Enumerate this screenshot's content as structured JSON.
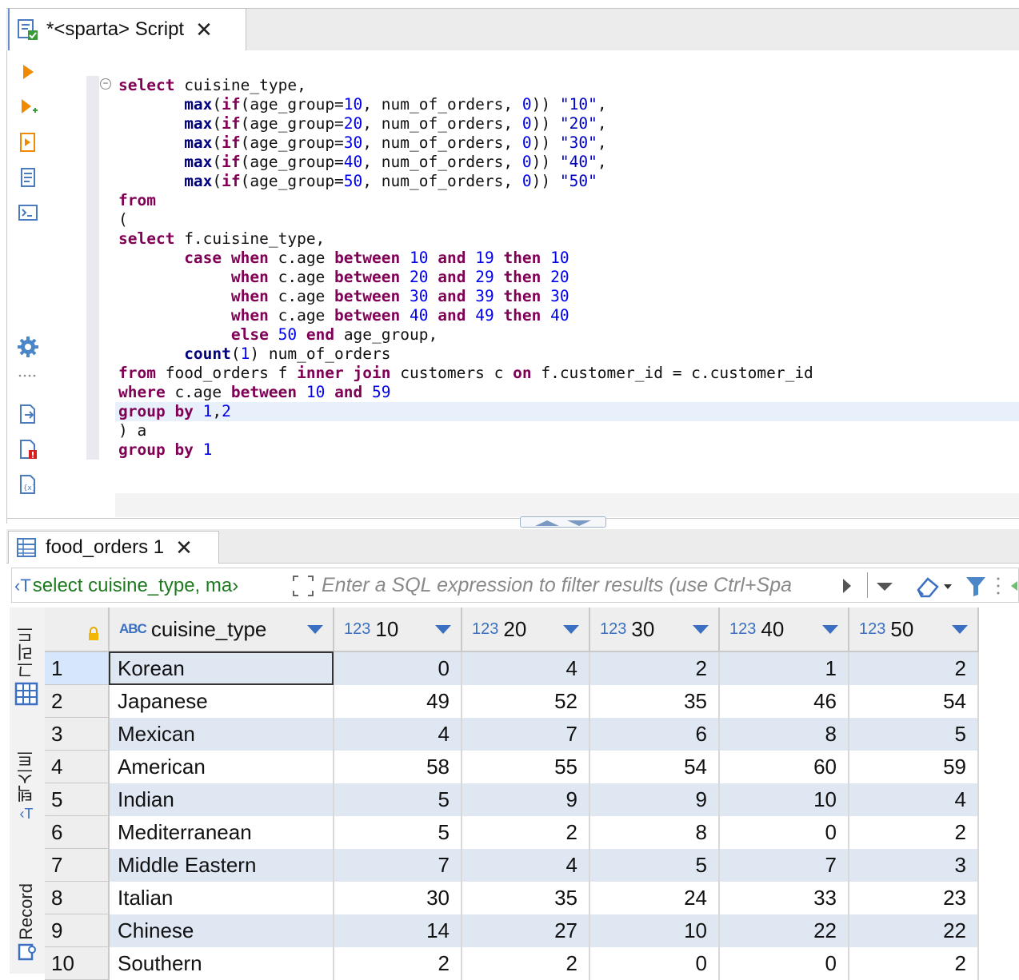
{
  "editor_tab": {
    "title": "*<sparta> Script",
    "close": "✕"
  },
  "results_tab": {
    "title": "food_orders 1",
    "close": "✕"
  },
  "filter": {
    "query_label": "select cuisine_type, ma›",
    "placeholder": "Enter a SQL expression to filter results (use Ctrl+Spa"
  },
  "side_tabs": {
    "grid": "그리드",
    "text": "텍스트",
    "record": "Record"
  },
  "grid": {
    "columns": [
      {
        "type": "ABC",
        "name": "cuisine_type"
      },
      {
        "type": "123",
        "name": "10"
      },
      {
        "type": "123",
        "name": "20"
      },
      {
        "type": "123",
        "name": "30"
      },
      {
        "type": "123",
        "name": "40"
      },
      {
        "type": "123",
        "name": "50"
      }
    ],
    "rows": [
      {
        "n": "1",
        "cuisine": "Korean",
        "v": [
          "0",
          "4",
          "2",
          "1",
          "2"
        ]
      },
      {
        "n": "2",
        "cuisine": "Japanese",
        "v": [
          "49",
          "52",
          "35",
          "46",
          "54"
        ]
      },
      {
        "n": "3",
        "cuisine": "Mexican",
        "v": [
          "4",
          "7",
          "6",
          "8",
          "5"
        ]
      },
      {
        "n": "4",
        "cuisine": "American",
        "v": [
          "58",
          "55",
          "54",
          "60",
          "59"
        ]
      },
      {
        "n": "5",
        "cuisine": "Indian",
        "v": [
          "5",
          "9",
          "9",
          "10",
          "4"
        ]
      },
      {
        "n": "6",
        "cuisine": "Mediterranean",
        "v": [
          "5",
          "2",
          "8",
          "0",
          "2"
        ]
      },
      {
        "n": "7",
        "cuisine": "Middle Eastern",
        "v": [
          "7",
          "4",
          "5",
          "7",
          "3"
        ]
      },
      {
        "n": "8",
        "cuisine": "Italian",
        "v": [
          "30",
          "35",
          "24",
          "33",
          "23"
        ]
      },
      {
        "n": "9",
        "cuisine": "Chinese",
        "v": [
          "14",
          "27",
          "10",
          "22",
          "22"
        ]
      },
      {
        "n": "10",
        "cuisine": "Southern",
        "v": [
          "2",
          "2",
          "0",
          "0",
          "2"
        ]
      }
    ]
  },
  "code_lines": [
    [
      [
        "kw",
        "select"
      ],
      [
        "id",
        " cuisine_type,"
      ]
    ],
    [
      [
        "id",
        "       "
      ],
      [
        "fn",
        "max"
      ],
      [
        "id",
        "("
      ],
      [
        "kw",
        "if"
      ],
      [
        "id",
        "(age_group="
      ],
      [
        "num",
        "10"
      ],
      [
        "id",
        ", num_of_orders, "
      ],
      [
        "num",
        "0"
      ],
      [
        "id",
        ")) "
      ],
      [
        "str",
        "\"10\""
      ],
      [
        "id",
        ","
      ]
    ],
    [
      [
        "id",
        "       "
      ],
      [
        "fn",
        "max"
      ],
      [
        "id",
        "("
      ],
      [
        "kw",
        "if"
      ],
      [
        "id",
        "(age_group="
      ],
      [
        "num",
        "20"
      ],
      [
        "id",
        ", num_of_orders, "
      ],
      [
        "num",
        "0"
      ],
      [
        "id",
        ")) "
      ],
      [
        "str",
        "\"20\""
      ],
      [
        "id",
        ","
      ]
    ],
    [
      [
        "id",
        "       "
      ],
      [
        "fn",
        "max"
      ],
      [
        "id",
        "("
      ],
      [
        "kw",
        "if"
      ],
      [
        "id",
        "(age_group="
      ],
      [
        "num",
        "30"
      ],
      [
        "id",
        ", num_of_orders, "
      ],
      [
        "num",
        "0"
      ],
      [
        "id",
        ")) "
      ],
      [
        "str",
        "\"30\""
      ],
      [
        "id",
        ","
      ]
    ],
    [
      [
        "id",
        "       "
      ],
      [
        "fn",
        "max"
      ],
      [
        "id",
        "("
      ],
      [
        "kw",
        "if"
      ],
      [
        "id",
        "(age_group="
      ],
      [
        "num",
        "40"
      ],
      [
        "id",
        ", num_of_orders, "
      ],
      [
        "num",
        "0"
      ],
      [
        "id",
        ")) "
      ],
      [
        "str",
        "\"40\""
      ],
      [
        "id",
        ","
      ]
    ],
    [
      [
        "id",
        "       "
      ],
      [
        "fn",
        "max"
      ],
      [
        "id",
        "("
      ],
      [
        "kw",
        "if"
      ],
      [
        "id",
        "(age_group="
      ],
      [
        "num",
        "50"
      ],
      [
        "id",
        ", num_of_orders, "
      ],
      [
        "num",
        "0"
      ],
      [
        "id",
        ")) "
      ],
      [
        "str",
        "\"50\""
      ]
    ],
    [
      [
        "kw",
        "from"
      ]
    ],
    [
      [
        "id",
        "("
      ]
    ],
    [
      [
        "kw",
        "select"
      ],
      [
        "id",
        " f.cuisine_type,"
      ]
    ],
    [
      [
        "id",
        "       "
      ],
      [
        "kw",
        "case"
      ],
      [
        "id",
        " "
      ],
      [
        "kw",
        "when"
      ],
      [
        "id",
        " c.age "
      ],
      [
        "kw",
        "between"
      ],
      [
        "id",
        " "
      ],
      [
        "num",
        "10"
      ],
      [
        "id",
        " "
      ],
      [
        "kw",
        "and"
      ],
      [
        "id",
        " "
      ],
      [
        "num",
        "19"
      ],
      [
        "id",
        " "
      ],
      [
        "kw",
        "then"
      ],
      [
        "id",
        " "
      ],
      [
        "num",
        "10"
      ]
    ],
    [
      [
        "id",
        "            "
      ],
      [
        "kw",
        "when"
      ],
      [
        "id",
        " c.age "
      ],
      [
        "kw",
        "between"
      ],
      [
        "id",
        " "
      ],
      [
        "num",
        "20"
      ],
      [
        "id",
        " "
      ],
      [
        "kw",
        "and"
      ],
      [
        "id",
        " "
      ],
      [
        "num",
        "29"
      ],
      [
        "id",
        " "
      ],
      [
        "kw",
        "then"
      ],
      [
        "id",
        " "
      ],
      [
        "num",
        "20"
      ]
    ],
    [
      [
        "id",
        "            "
      ],
      [
        "kw",
        "when"
      ],
      [
        "id",
        " c.age "
      ],
      [
        "kw",
        "between"
      ],
      [
        "id",
        " "
      ],
      [
        "num",
        "30"
      ],
      [
        "id",
        " "
      ],
      [
        "kw",
        "and"
      ],
      [
        "id",
        " "
      ],
      [
        "num",
        "39"
      ],
      [
        "id",
        " "
      ],
      [
        "kw",
        "then"
      ],
      [
        "id",
        " "
      ],
      [
        "num",
        "30"
      ]
    ],
    [
      [
        "id",
        "            "
      ],
      [
        "kw",
        "when"
      ],
      [
        "id",
        " c.age "
      ],
      [
        "kw",
        "between"
      ],
      [
        "id",
        " "
      ],
      [
        "num",
        "40"
      ],
      [
        "id",
        " "
      ],
      [
        "kw",
        "and"
      ],
      [
        "id",
        " "
      ],
      [
        "num",
        "49"
      ],
      [
        "id",
        " "
      ],
      [
        "kw",
        "then"
      ],
      [
        "id",
        " "
      ],
      [
        "num",
        "40"
      ]
    ],
    [
      [
        "id",
        "            "
      ],
      [
        "kw",
        "else"
      ],
      [
        "id",
        " "
      ],
      [
        "num",
        "50"
      ],
      [
        "id",
        " "
      ],
      [
        "kw",
        "end"
      ],
      [
        "id",
        " age_group,"
      ]
    ],
    [
      [
        "id",
        "       "
      ],
      [
        "fn",
        "count"
      ],
      [
        "id",
        "("
      ],
      [
        "num",
        "1"
      ],
      [
        "id",
        ") num_of_orders"
      ]
    ],
    [
      [
        "kw",
        "from"
      ],
      [
        "id",
        " food_orders f "
      ],
      [
        "kw",
        "inner join"
      ],
      [
        "id",
        " customers c "
      ],
      [
        "kw",
        "on"
      ],
      [
        "id",
        " f.customer_id = c.customer_id"
      ]
    ],
    [
      [
        "kw",
        "where"
      ],
      [
        "id",
        " c.age "
      ],
      [
        "kw",
        "between"
      ],
      [
        "id",
        " "
      ],
      [
        "num",
        "10"
      ],
      [
        "id",
        " "
      ],
      [
        "kw",
        "and"
      ],
      [
        "id",
        " "
      ],
      [
        "num",
        "59"
      ]
    ],
    [
      [
        "kw",
        "group by"
      ],
      [
        "id",
        " "
      ],
      [
        "num",
        "1"
      ],
      [
        "id",
        ","
      ],
      [
        "num",
        "2"
      ]
    ],
    [
      [
        "id",
        ") a"
      ]
    ],
    [
      [
        "kw",
        "group by"
      ],
      [
        "id",
        " "
      ],
      [
        "num",
        "1"
      ]
    ]
  ],
  "colors": {
    "keyword": "#7f0055",
    "number": "#0000ee",
    "accent": "#3a6fc2",
    "row_stripe": "#dfe7f3"
  }
}
